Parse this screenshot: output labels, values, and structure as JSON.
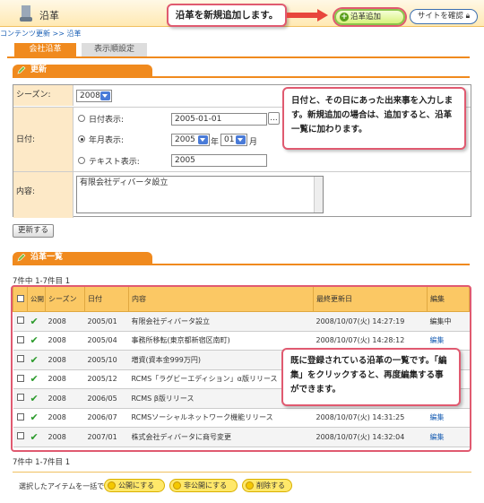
{
  "header": {
    "title": "沿革",
    "add_button": "沿革追加",
    "site_button": "サイトを確認"
  },
  "callouts": {
    "add": "沿革を新規追加します。",
    "form": "日付と、その日にあった出来事を入力します。新規追加の場合は、追加すると、沿革一覧に加わります。",
    "list": "既に登録されている沿革の一覧です。「編集」をクリックすると、再度編集する事ができます。"
  },
  "breadcrumb": "コンテンツ更新 >> 沿革",
  "tabs": [
    {
      "label": "会社沿革"
    },
    {
      "label": "表示順設定"
    }
  ],
  "update_section": {
    "title": "更新",
    "season_label": "シーズン:",
    "season_value": "2008",
    "date_label": "日付:",
    "date_mode_daily": "日付表示:",
    "date_daily_value": "2005-01-01",
    "date_picker": "...",
    "date_mode_month": "年月表示:",
    "month_year": "2005",
    "month_year_unit": "年",
    "month_month": "01",
    "month_month_unit": "月",
    "date_mode_text": "テキスト表示:",
    "date_text_value": "2005",
    "content_label": "内容:",
    "content_value": "有限会社ディバータ設立",
    "submit": "更新する"
  },
  "list_section": {
    "title": "沿革一覧",
    "count_top": "7件中 1-7件目 1",
    "count_bottom": "7件中 1-7件目 1",
    "columns": [
      "公開",
      "シーズン",
      "日付",
      "内容",
      "最終更新日",
      "編集"
    ],
    "rows": [
      {
        "season": "2008",
        "date": "2005/01",
        "content": "有限会社ディバータ設立",
        "updated": "2008/10/07(火) 14:27:19",
        "edit": "編集中"
      },
      {
        "season": "2008",
        "date": "2005/04",
        "content": "事務所移転(東京都新宿区南町)",
        "updated": "2008/10/07(火) 14:28:12",
        "edit": "編集"
      },
      {
        "season": "2008",
        "date": "2005/10",
        "content": "増資(資本金999万円)",
        "updated": "",
        "edit": ""
      },
      {
        "season": "2008",
        "date": "2005/12",
        "content": "RCMS「ラグビーエディション」α版リリース",
        "updated": "",
        "edit": ""
      },
      {
        "season": "2008",
        "date": "2006/05",
        "content": "RCMS β版リリース",
        "updated": "",
        "edit": ""
      },
      {
        "season": "2008",
        "date": "2006/07",
        "content": "RCMSソーシャルネットワーク機能リリース",
        "updated": "2008/10/07(火) 14:31:25",
        "edit": "編集"
      },
      {
        "season": "2008",
        "date": "2007/01",
        "content": "株式会社ディバータに商号変更",
        "updated": "2008/10/07(火) 14:32:04",
        "edit": "編集"
      }
    ],
    "check_mark": "✔"
  },
  "bulk": {
    "label": "選択したアイテムを一括で",
    "publish": "公開にする",
    "unpublish": "非公開にする",
    "delete": "削除する"
  }
}
